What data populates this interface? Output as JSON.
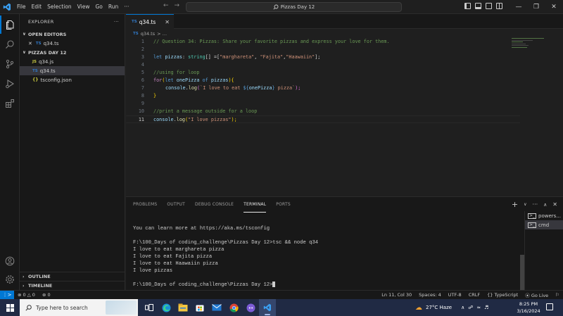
{
  "window": {
    "title": "Pizzas Day 12"
  },
  "menu": [
    "File",
    "Edit",
    "Selection",
    "View",
    "Go",
    "Run",
    "···"
  ],
  "sidebar": {
    "title": "EXPLORER",
    "more": "···",
    "open_editors_label": "OPEN EDITORS",
    "open_editor": {
      "badge": "TS",
      "name": "q34.ts"
    },
    "folder_label": "PIZZAS DAY 12",
    "files": [
      {
        "badge": "JS",
        "name": "q34.js"
      },
      {
        "badge": "TS",
        "name": "q34.ts"
      },
      {
        "badge": "{}",
        "name": "tsconfig.json"
      }
    ],
    "outline_label": "OUTLINE",
    "timeline_label": "TIMELINE"
  },
  "editor": {
    "tab": {
      "badge": "TS",
      "name": "q34.ts"
    },
    "breadcrumb": {
      "badge": "TS",
      "name": "q34.ts",
      "sep": "> …"
    },
    "line_numbers": [
      "1",
      "2",
      "3",
      "4",
      "5",
      "6",
      "7",
      "8",
      "9",
      "10",
      "11"
    ],
    "lines": {
      "l1": "// Question 34: Pizzas: Share your favorite pizzas and express your love for them.",
      "l3_kw": "let ",
      "l3_var": "pizzas",
      "l3_p1": ": ",
      "l3_type": "string",
      "l3_p2": "[] =[",
      "l3_s1": "\"marghareta\"",
      "l3_p3": ", ",
      "l3_s2": "\"Fajita\"",
      "l3_p4": ",",
      "l3_s3": "\"Haawaiin\"",
      "l3_p5": "];",
      "l5": "//using for loop",
      "l6_kw": "for",
      "l6_p1": "(",
      "l6_let": "let ",
      "l6_v1": "onePizza",
      "l6_of": " of ",
      "l6_v2": "pizzas",
      "l6_p2": "){",
      "l7_obj": "console",
      "l7_dot": ".",
      "l7_fn": "log",
      "l7_p1": "(",
      "l7_s1": "`I love to eat ",
      "l7_i1": "${",
      "l7_iv": "onePizza",
      "l7_i2": "}",
      "l7_s2": " pizza`",
      "l7_p2": ");",
      "l8": "}",
      "l10": "//print a message outside for a loop",
      "l11_obj": "console",
      "l11_dot": ".",
      "l11_fn": "log",
      "l11_p1": "(",
      "l11_s": "\"I love pizzas\"",
      "l11_p2": ");"
    }
  },
  "panel": {
    "tabs": [
      "PROBLEMS",
      "OUTPUT",
      "DEBUG CONSOLE",
      "TERMINAL",
      "PORTS"
    ],
    "terminal_lines": [
      "You can learn more at https://aka.ms/tsconfig",
      "",
      "F:\\100_Days of coding_challenge\\Pizzas Day 12>tsc && node q34",
      "I love to eat marghareta pizza",
      "I love to eat Fajita pizza",
      "I love to eat Haawaiin pizza",
      "I love pizzas",
      "",
      "F:\\100_Days of coding_challenge\\Pizzas Day 12>"
    ],
    "terminals": [
      "powers...",
      "cmd"
    ]
  },
  "status": {
    "errors": "0",
    "warnings": "0",
    "ports": "0",
    "position": "Ln 11, Col 30",
    "spaces": "Spaces: 4",
    "encoding": "UTF-8",
    "eol": "CRLF",
    "language": "{} TypeScript",
    "golive": "Go Live"
  },
  "taskbar": {
    "search_placeholder": "Type here to search",
    "weather": "27°C  Haze",
    "time": "8:25 PM",
    "date": "3/16/2024"
  },
  "colors": {
    "accent": "#0078d4",
    "taskbar": "#202a44"
  }
}
